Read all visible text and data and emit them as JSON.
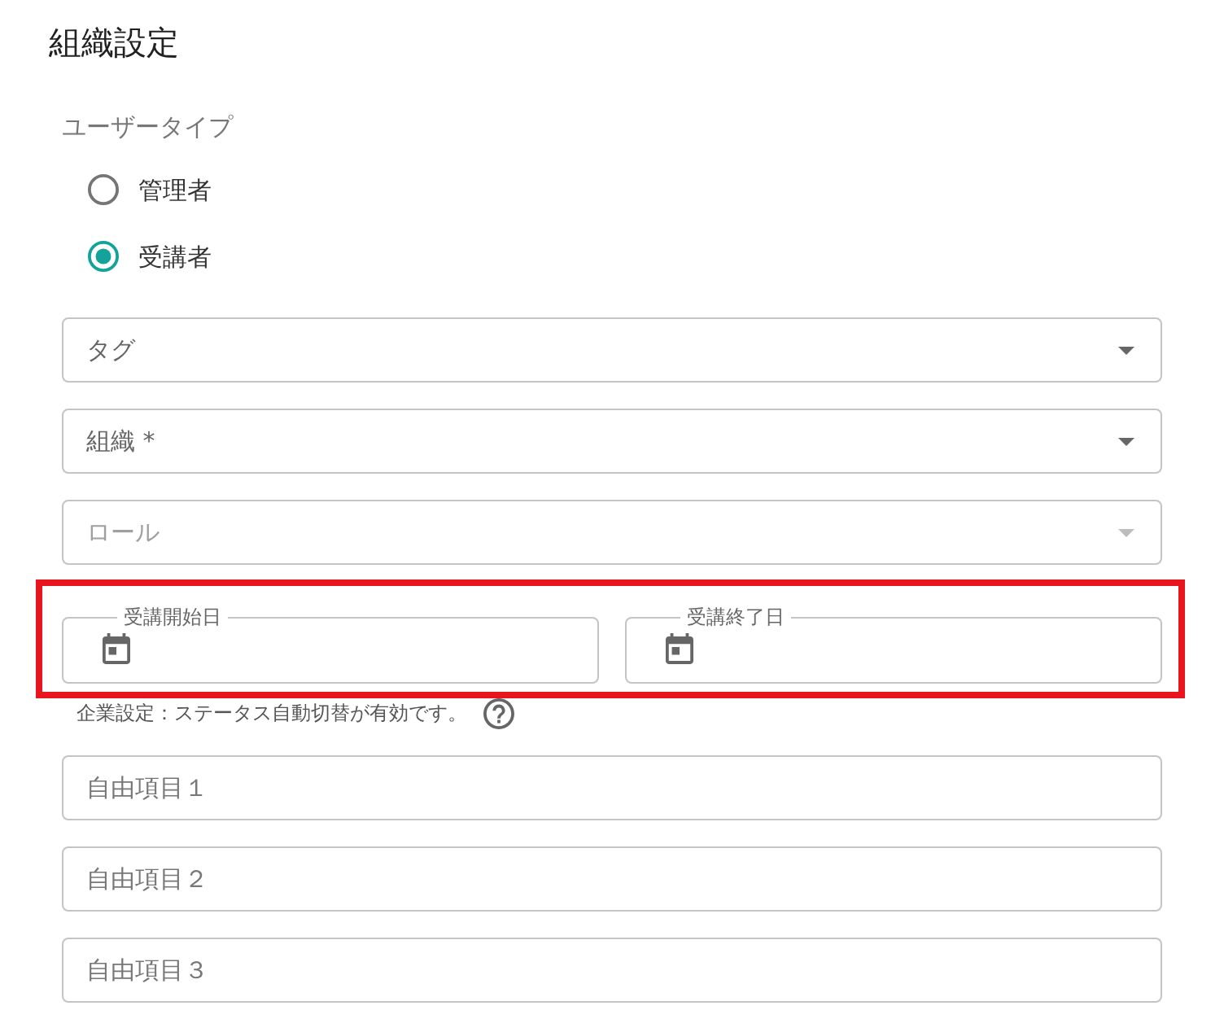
{
  "title": "組織設定",
  "user_type": {
    "label": "ユーザータイプ",
    "options": [
      {
        "label": "管理者",
        "selected": false
      },
      {
        "label": "受講者",
        "selected": true
      }
    ]
  },
  "selects": [
    {
      "label": "タグ",
      "disabled": false
    },
    {
      "label": "組織 *",
      "disabled": false
    },
    {
      "label": "ロール",
      "disabled": true
    }
  ],
  "period": {
    "highlighted": true,
    "fields": [
      {
        "label": "受講開始日"
      },
      {
        "label": "受講終了日"
      }
    ],
    "note": "企業設定：ステータス自動切替が有効です。"
  },
  "free_fields": [
    {
      "placeholder": "自由項目１"
    },
    {
      "placeholder": "自由項目２"
    },
    {
      "placeholder": "自由項目３"
    }
  ]
}
